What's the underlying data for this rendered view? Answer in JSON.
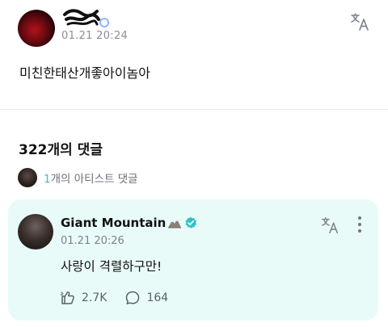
{
  "post": {
    "time": "01.21 20:24",
    "body": "미친한태산개좋아이놈아"
  },
  "comments_section": {
    "count_label": "322개의 댓글",
    "artist_count": "1",
    "artist_label": "개의 아티스트 댓글"
  },
  "comment": {
    "author": "Giant Mountain",
    "time": "01.21 20:26",
    "body": "사랑이 격렬하구만!",
    "likes": "2.7K",
    "replies": "164"
  },
  "colors": {
    "accent": "#35c4c8",
    "card_bg": "#e9fbf8",
    "verified": "#2fc2c6"
  },
  "icons": [
    "translate-icon",
    "verified-icon",
    "more-icon",
    "like-icon",
    "reply-icon",
    "mountain-emoji-icon"
  ]
}
